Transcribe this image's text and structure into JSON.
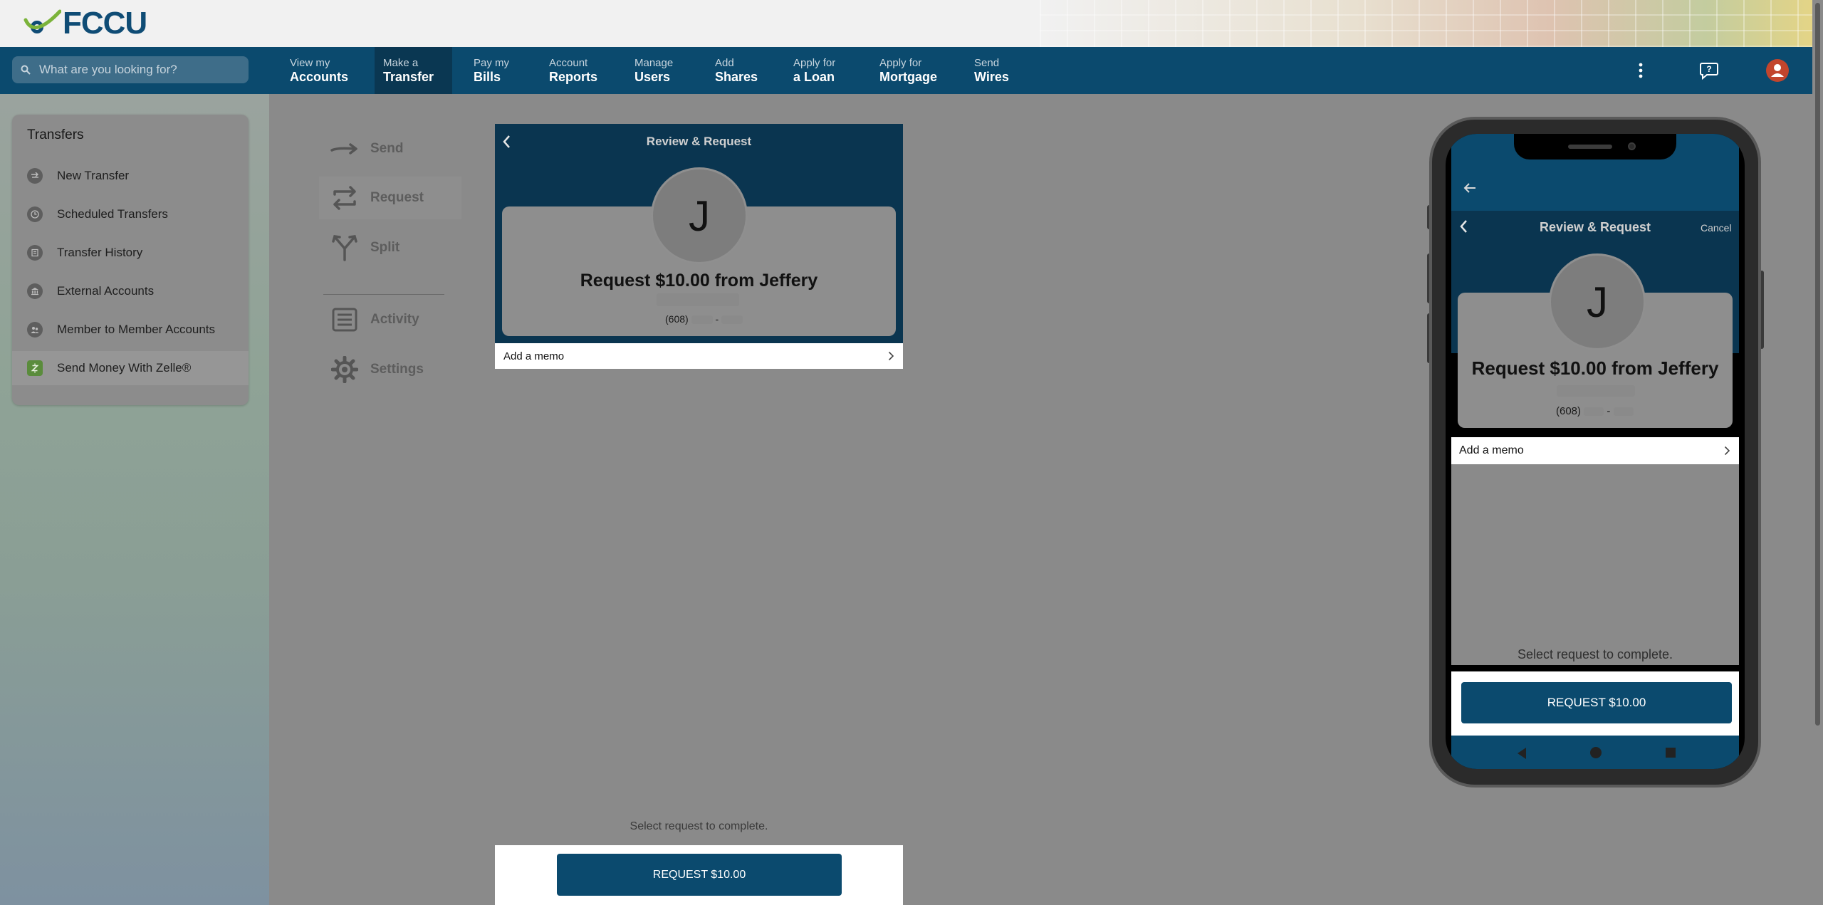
{
  "brand": {
    "logo_text": "FCCU"
  },
  "search": {
    "placeholder": "What are you looking for?"
  },
  "nav": {
    "items": [
      {
        "line1": "View my",
        "line2": "Accounts"
      },
      {
        "line1": "Make a",
        "line2": "Transfer"
      },
      {
        "line1": "Pay my",
        "line2": "Bills"
      },
      {
        "line1": "Account",
        "line2": "Reports"
      },
      {
        "line1": "Manage",
        "line2": "Users"
      },
      {
        "line1": "Add",
        "line2": "Shares"
      },
      {
        "line1": "Apply for",
        "line2": "a Loan"
      },
      {
        "line1": "Apply for",
        "line2": "Mortgage"
      },
      {
        "line1": "Send",
        "line2": "Wires"
      }
    ],
    "active_index": 1
  },
  "sidebar": {
    "title": "Transfers",
    "items": [
      {
        "label": "New Transfer",
        "icon": "transfer-icon"
      },
      {
        "label": "Scheduled Transfers",
        "icon": "clock-icon"
      },
      {
        "label": "Transfer History",
        "icon": "history-icon"
      },
      {
        "label": "External Accounts",
        "icon": "bank-icon"
      },
      {
        "label": "Member to Member Accounts",
        "icon": "people-icon"
      },
      {
        "label": "Send Money With Zelle®",
        "icon": "zelle-icon"
      }
    ],
    "active_index": 5
  },
  "zelle_tabs": {
    "send": "Send",
    "request": "Request",
    "split": "Split",
    "activity": "Activity",
    "settings": "Settings"
  },
  "review": {
    "title": "Review & Request",
    "cancel": "Cancel",
    "avatar_initial": "J",
    "request_text": "Request $10.00 from Jeffery",
    "phone_prefix": "(608)",
    "phone_sep": "-",
    "memo_label": "Add a memo",
    "status_text": "Select request to complete.",
    "button_label": "REQUEST $10.00"
  }
}
